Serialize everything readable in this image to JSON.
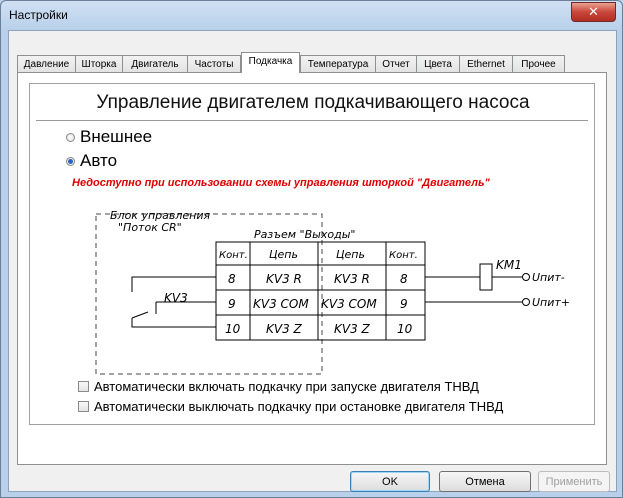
{
  "window": {
    "title": "Настройки"
  },
  "tabs": [
    "Давление",
    "Шторка",
    "Двигатель",
    "Частоты",
    "Подкачка",
    "Температура",
    "Отчет",
    "Цвета",
    "Ethernet",
    "Прочее"
  ],
  "active_tab": "Подкачка",
  "panel": {
    "heading": "Управление двигателем подкачивающего насоса",
    "radio_options": [
      {
        "label": "Внешнее",
        "selected": false
      },
      {
        "label": "Авто",
        "selected": true
      }
    ],
    "warning": "Недоступно при использовании схемы управления шторкой \"Двигатель\"",
    "diagram": {
      "block_label_line1": "Блок управления",
      "block_label_line2": "\"Поток CR\"",
      "connector_label": "Разъем \"Выходы\"",
      "col_cont": "Конт.",
      "col_circuit": "Цепь",
      "relay_label": "KV3",
      "rows": [
        {
          "cont": "8",
          "circuit": "KV3 R"
        },
        {
          "cont": "9",
          "circuit": "KV3 COM"
        },
        {
          "cont": "10",
          "circuit": "KV3 Z"
        }
      ],
      "coil_label": "KM1",
      "minus_label": "Uпит-",
      "plus_label": "Uпит+"
    },
    "checkboxes": [
      {
        "label": "Автоматически включать подкачку при запуске двигателя ТНВД",
        "checked": false
      },
      {
        "label": "Автоматически выключать подкачку при остановке двигателя ТНВД",
        "checked": false
      }
    ]
  },
  "buttons": {
    "ok": "OK",
    "cancel": "Отмена",
    "apply": "Применить"
  }
}
